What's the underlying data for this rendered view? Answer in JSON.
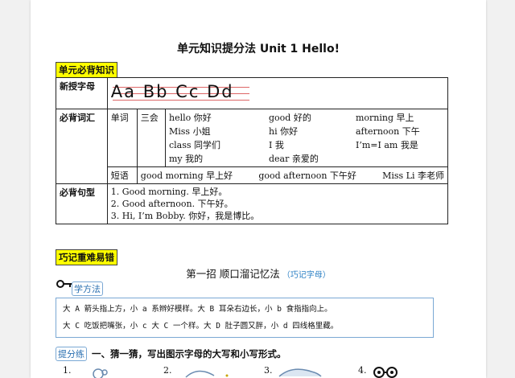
{
  "doc": {
    "title": "单元知识提分法  Unit 1 Hello!"
  },
  "section1": {
    "tag": "单元必背知识",
    "rows": {
      "letters_label": "新授字母",
      "letters": [
        "Aa",
        "Bb",
        "Cc",
        "Dd"
      ],
      "vocab_label": "必背词汇",
      "vocab_sub1": "单词",
      "vocab_sub2": "三会",
      "words": [
        "hello 你好",
        "good 好的",
        "morning 早上",
        "Miss 小姐",
        "hi 你好",
        "afternoon 下午",
        "class 同学们",
        "I 我",
        "I’m=I am 我是",
        "my 我的",
        "dear 亲爱的",
        ""
      ],
      "phrase_label": "短语",
      "phrases": [
        "good morning 早上好",
        "good afternoon 下午好",
        "Miss Li 李老师"
      ],
      "sentence_label": "必背句型",
      "sentences": [
        "1. Good morning.  早上好。",
        "2. Good afternoon.  下午好。",
        "3. Hi, I’m Bobby.  你好，我是博比。"
      ]
    }
  },
  "section2": {
    "tag": "巧记重难易错",
    "title": "第一招  顺口溜记忆法",
    "subtitle": "（巧记字母）",
    "method_label": "学方法",
    "method_lines": [
      "大 A 箭头指上方，小 a 系辫好模样。大 B 耳朵右边长，小 b 食指指向上。",
      "大 C 吃饭把嘴张，小 c 大 C 一个样。大 D 肚子圆又胖，小 d 四线格里藏。"
    ],
    "practice_label": "提分练",
    "exercise_title": "一、猜一猜，写出图示字母的大写和小写形式。",
    "exercise_numbers": [
      "1.",
      "2.",
      "3.",
      "4."
    ]
  }
}
